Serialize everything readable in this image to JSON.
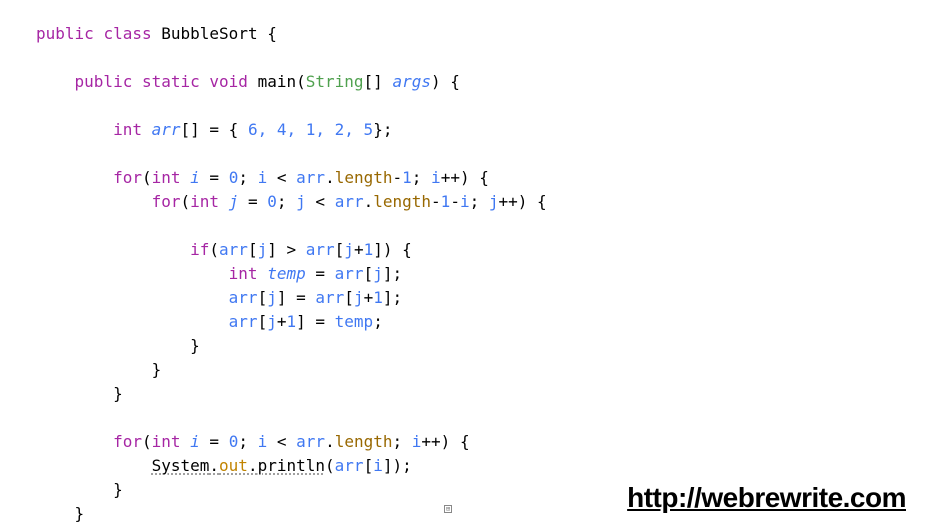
{
  "code": {
    "l1": {
      "kw1": "public",
      "kw2": "class",
      "cls": "BubbleSort",
      "brace": " {"
    },
    "l2": {
      "kw1": "public",
      "kw2": "static",
      "kw3": "void",
      "fn": "main",
      "open": "(",
      "type": "String",
      "brk": "[] ",
      "arg": "args",
      "close": ") {"
    },
    "l3": {
      "type": "int",
      "var": "arr",
      "brk": "[] = { ",
      "vals": "6, 4, 1, 2, 5",
      "end": "};"
    },
    "l4": {
      "kw": "for",
      "open": "(",
      "type": "int",
      "v": "i",
      "eq": " = ",
      "z": "0",
      "cond1": "; ",
      "v2": "i",
      "lt": " < ",
      "arr": "arr",
      "dot": ".",
      "len": "length",
      "minus": "-",
      "one": "1",
      "cond2": "; ",
      "v3": "i",
      "inc": "++) {"
    },
    "l5": {
      "kw": "for",
      "open": "(",
      "type": "int",
      "v": "j",
      "eq": " = ",
      "z": "0",
      "cond1": "; ",
      "v2": "j",
      "lt": " < ",
      "arr": "arr",
      "dot": ".",
      "len": "length",
      "minus": "-",
      "one": "1",
      "minus2": "-",
      "iv": "i",
      "cond2": "; ",
      "v3": "j",
      "inc": "++) {"
    },
    "l6": {
      "kw": "if",
      "open": "(",
      "arr1": "arr",
      "b1": "[",
      "j1": "j",
      "b2": "] > ",
      "arr2": "arr",
      "b3": "[",
      "j2": "j",
      "plus": "+",
      "one": "1",
      "b4": "]) {"
    },
    "l7": {
      "type": "int",
      "tmp": "temp",
      "eq": " = ",
      "arr": "arr",
      "b1": "[",
      "j": "j",
      "b2": "];"
    },
    "l8": {
      "arr1": "arr",
      "b1": "[",
      "j1": "j",
      "b2": "] = ",
      "arr2": "arr",
      "b3": "[",
      "j2": "j",
      "plus": "+",
      "one": "1",
      "b4": "];"
    },
    "l9": {
      "arr": "arr",
      "b1": "[",
      "j": "j",
      "plus": "+",
      "one": "1",
      "b2": "] = ",
      "tmp": "temp",
      "end": ";"
    },
    "l10": {
      "brace": "}"
    },
    "l11": {
      "brace": "}"
    },
    "l12": {
      "brace": "}"
    },
    "l13": {
      "kw": "for",
      "open": "(",
      "type": "int",
      "v": "i",
      "eq": " = ",
      "z": "0",
      "cond1": "; ",
      "v2": "i",
      "lt": " < ",
      "arr": "arr",
      "dot": ".",
      "len": "length",
      "cond2": "; ",
      "v3": "i",
      "inc": "++) {"
    },
    "l14": {
      "sys": "System",
      "dot1": ".",
      "out": "out",
      "dot2": ".",
      "fn": "println",
      "open": "(",
      "arr": "arr",
      "b1": "[",
      "i": "i",
      "b2": "]);"
    },
    "l15": {
      "brace": "}"
    },
    "l16": {
      "brace": "}"
    }
  },
  "watermark": "http://webrewrite.com",
  "handle_glyph": "⊞"
}
